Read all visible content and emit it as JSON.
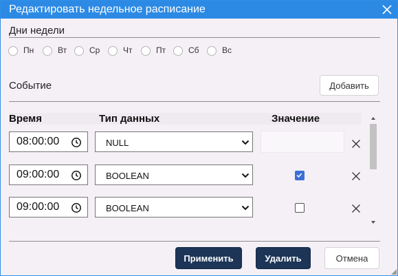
{
  "dialog": {
    "title": "Редактировать недельное расписание",
    "close_icon": "close-icon"
  },
  "days": {
    "label": "Дни недели",
    "options": [
      {
        "label": "Пн",
        "checked": false
      },
      {
        "label": "Вт",
        "checked": false
      },
      {
        "label": "Ср",
        "checked": false
      },
      {
        "label": "Чт",
        "checked": true
      },
      {
        "label": "Пт",
        "checked": false
      },
      {
        "label": "Сб",
        "checked": false
      },
      {
        "label": "Вс",
        "checked": false
      }
    ]
  },
  "event": {
    "label": "Событие",
    "add_label": "Добавить"
  },
  "table": {
    "headers": {
      "time": "Время",
      "type": "Тип данных",
      "value": "Значение"
    },
    "rows": [
      {
        "time": "08:00:00",
        "type": "NULL",
        "value_kind": "empty"
      },
      {
        "time": "09:00:00",
        "type": "BOOLEAN",
        "value_kind": "checkbox",
        "checked": true
      },
      {
        "time": "09:00:00",
        "type": "BOOLEAN",
        "value_kind": "checkbox",
        "checked": false
      }
    ],
    "icons": {
      "time": "clock-icon",
      "select": "chevron-down-icon",
      "delete": "close-icon"
    }
  },
  "footer": {
    "apply_label": "Применить",
    "delete_label": "Удалить",
    "cancel_label": "Отмена"
  },
  "colors": {
    "title_bar": "#2c8ae5",
    "dialog_bg": "#f5f0f6",
    "primary_button": "#1d3557",
    "checkbox_accent": "#3b6fd6"
  }
}
